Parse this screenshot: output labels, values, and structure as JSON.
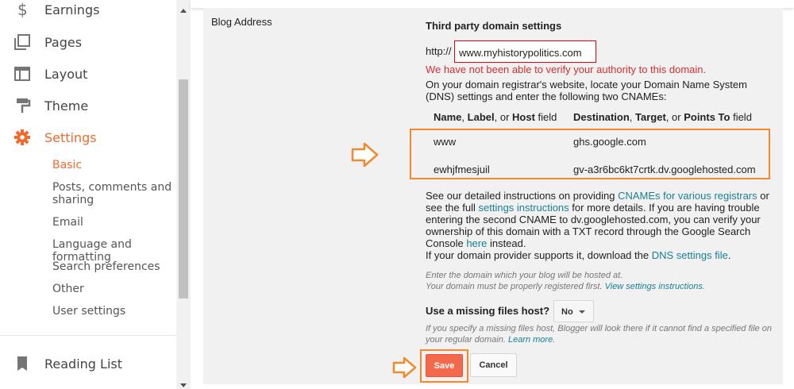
{
  "sidebar": {
    "items": [
      {
        "label": "Earnings",
        "icon": "dollar-icon"
      },
      {
        "label": "Pages",
        "icon": "pages-icon"
      },
      {
        "label": "Layout",
        "icon": "layout-icon"
      },
      {
        "label": "Theme",
        "icon": "theme-icon"
      },
      {
        "label": "Settings",
        "icon": "gear-icon"
      }
    ],
    "settings_sub": [
      {
        "label": "Basic"
      },
      {
        "label": "Posts, comments and sharing"
      },
      {
        "label": "Email"
      },
      {
        "label": "Language and formatting"
      },
      {
        "label": "Search preferences"
      },
      {
        "label": "Other"
      },
      {
        "label": "User settings"
      }
    ],
    "reading_list": {
      "label": "Reading List",
      "icon": "bookmark-icon"
    }
  },
  "main": {
    "section_label": "Blog Address",
    "third_party_title": "Third party domain settings",
    "http_prefix": "http://",
    "domain_value": "www.myhistorypolitics.com",
    "error_text": "We have not been able to verify your authority to this domain.",
    "instructions": "On your domain registrar's website, locate your Domain Name System (DNS) settings and enter the following two CNAMEs:",
    "table": {
      "col1": {
        "p1": "Name",
        "p2": ", ",
        "p3": "Label",
        "p4": ", or ",
        "p5": "Host",
        "p6": " field"
      },
      "col2": {
        "p1": "Destination",
        "p2": ", ",
        "p3": "Target",
        "p4": ", or ",
        "p5": "Points To",
        "p6": " field"
      },
      "rows": [
        {
          "name": "www",
          "destination": "ghs.google.com"
        },
        {
          "name": "ewhjfmesjuil",
          "destination": "gv-a3r6bc6kt7crtk.dv.googlehosted.com"
        }
      ]
    },
    "detail": {
      "t1": "See our detailed instructions on providing ",
      "link1": "CNAMEs for various registrars",
      "t2": " or see the full ",
      "link2": "settings instructions",
      "t3": " for more details. If you are having trouble entering the second CNAME to dv.googlehosted.com, you can verify your ownership of this domain with a TXT record through the Google Search Console ",
      "link3": "here",
      "t4": " instead.",
      "t5": "If your domain provider supports it, download the ",
      "link4": "DNS settings file",
      "t6": "."
    },
    "hint1": {
      "l1": "Enter the domain which your blog will be hosted at.",
      "l2": "Your domain must be properly registered first. ",
      "link": "View settings instructions",
      "end": "."
    },
    "missing_host_label": "Use a missing files host?",
    "missing_host_value": "No",
    "hint2": {
      "text": "If you specify a missing files host, Blogger will look there if it cannot find a specified file on your regular domain. ",
      "link": "Learn more",
      "end": "."
    },
    "save_label": "Save",
    "cancel_label": "Cancel"
  },
  "colors": {
    "accent": "#f26a2c",
    "save_button": "#f26a4b",
    "highlight_outline": "#f08a2c",
    "error": "#d32f2f",
    "link": "#1a7f94"
  }
}
